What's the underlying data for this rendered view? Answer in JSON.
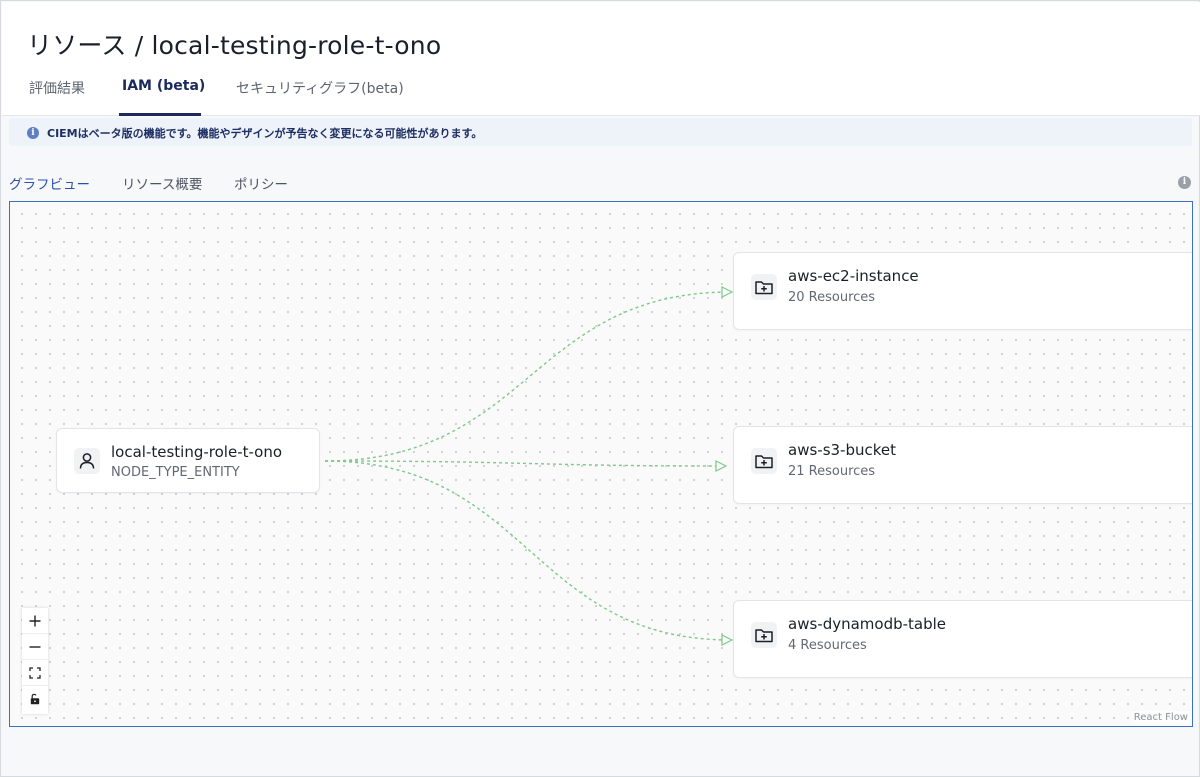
{
  "header": {
    "title": "リソース / local-testing-role-t-ono",
    "tabs": [
      {
        "label": "評価結果",
        "active": false
      },
      {
        "label": "IAM (beta)",
        "active": true
      },
      {
        "label": "セキュリティグラフ(beta)",
        "active": false
      }
    ]
  },
  "banner": {
    "icon": "info-icon",
    "text": "CIEMはベータ版の機能です。機能やデザインが予告なく変更になる可能性があります。"
  },
  "subtabs": [
    {
      "label": "グラフビュー",
      "active": true
    },
    {
      "label": "リソース概要",
      "active": false
    },
    {
      "label": "ポリシー",
      "active": false
    }
  ],
  "graph": {
    "source": {
      "title": "local-testing-role-t-ono",
      "subtitle": "NODE_TYPE_ENTITY",
      "icon": "user-icon"
    },
    "targets": [
      {
        "title": "aws-ec2-instance",
        "subtitle": "20 Resources",
        "icon": "folder-plus-icon"
      },
      {
        "title": "aws-s3-bucket",
        "subtitle": "21 Resources",
        "icon": "folder-plus-icon"
      },
      {
        "title": "aws-dynamodb-table",
        "subtitle": "4 Resources",
        "icon": "folder-plus-icon"
      }
    ],
    "edge_color": "#7cc98a",
    "attribution": "React Flow"
  },
  "colors": {
    "accent": "#1b2a5c",
    "subtab_active": "#2c50a8",
    "canvas_border": "#3d6fc4"
  }
}
